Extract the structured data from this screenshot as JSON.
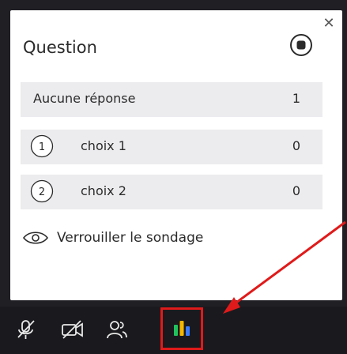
{
  "dialog": {
    "close_glyph": "✕",
    "title": "Question",
    "header_row": {
      "label": "Aucune réponse",
      "count": "1"
    },
    "choices": [
      {
        "number": "1",
        "label": "choix 1",
        "count": "0"
      },
      {
        "number": "2",
        "label": "choix 2",
        "count": "0"
      }
    ],
    "lock_label": "Verrouiller le sondage"
  },
  "toolbar": {
    "buttons": [
      {
        "name": "microphone-muted-icon"
      },
      {
        "name": "camera-off-icon"
      },
      {
        "name": "participants-icon"
      },
      {
        "name": "poll-results-icon"
      }
    ]
  },
  "colors": {
    "accent_red": "#e01a1a",
    "poll_green": "#21c25e",
    "poll_yellow": "#f5b800",
    "poll_blue": "#3b7bff"
  }
}
